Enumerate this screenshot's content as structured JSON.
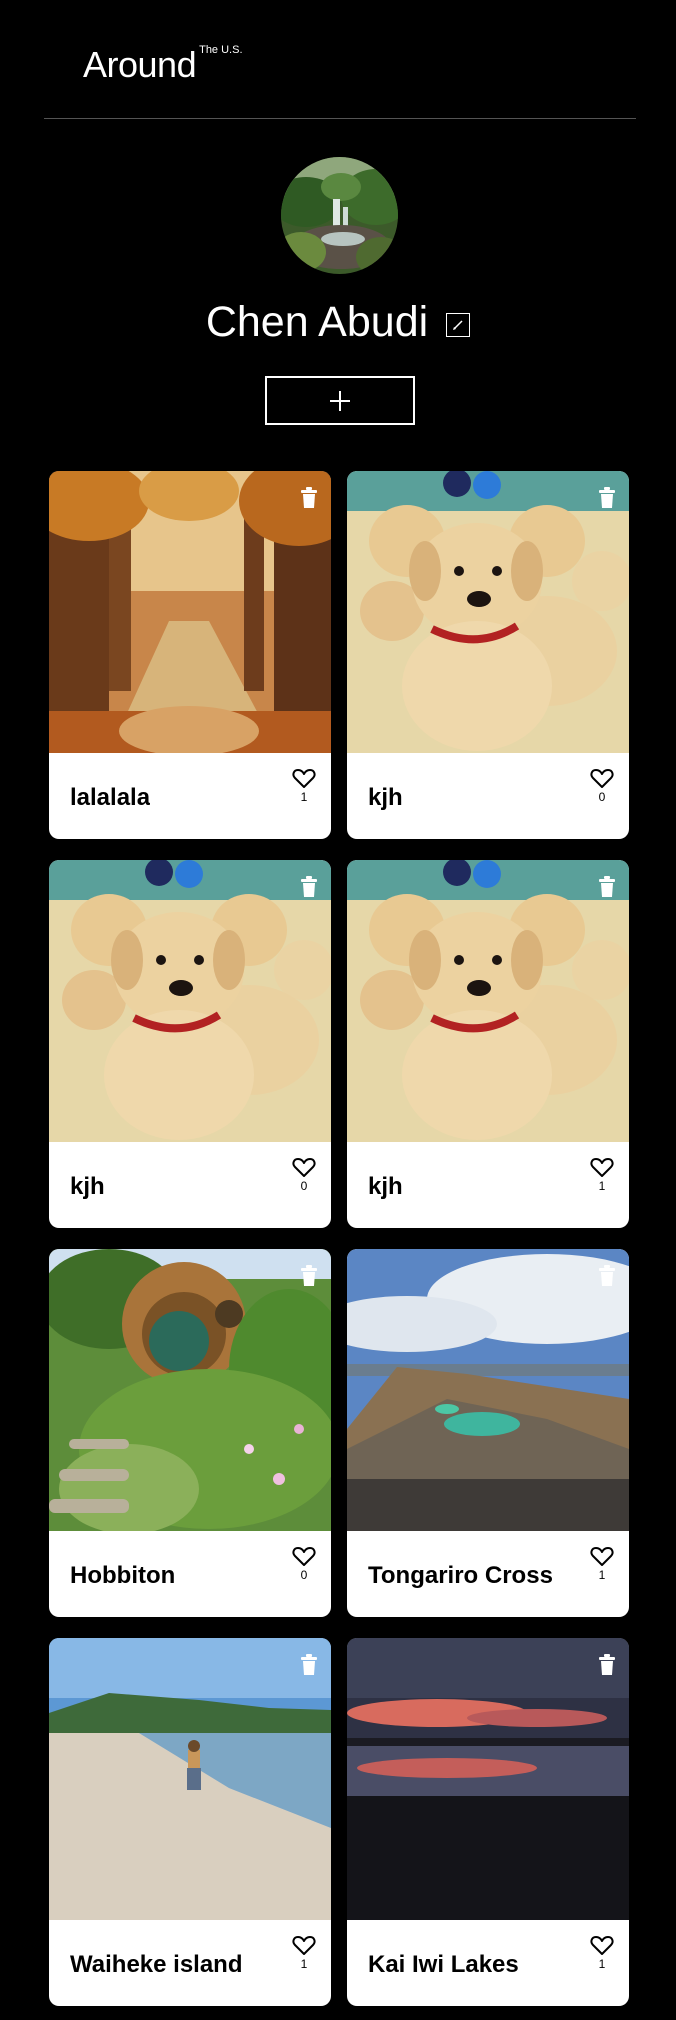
{
  "header": {
    "logo_main": "Around",
    "logo_sup": "The U.S."
  },
  "profile": {
    "name": "Chen Abudi"
  },
  "add_button_label": "+",
  "cards": [
    {
      "title": "lalalala",
      "likes": "1",
      "image": "autumn-forest-path"
    },
    {
      "title": "kjh",
      "likes": "0",
      "image": "puppies"
    },
    {
      "title": "kjh",
      "likes": "0",
      "image": "puppies"
    },
    {
      "title": "kjh",
      "likes": "1",
      "image": "puppies"
    },
    {
      "title": "Hobbiton",
      "likes": "0",
      "image": "hobbit-hole"
    },
    {
      "title": "Tongariro Cross",
      "likes": "1",
      "image": "volcanic-lakes"
    },
    {
      "title": "Waiheke island",
      "likes": "1",
      "image": "beach"
    },
    {
      "title": "Kai Iwi Lakes",
      "likes": "1",
      "image": "sunset-lake"
    }
  ],
  "icons": {
    "trash": "trash-icon",
    "heart": "heart-icon",
    "edit": "pencil-icon"
  }
}
